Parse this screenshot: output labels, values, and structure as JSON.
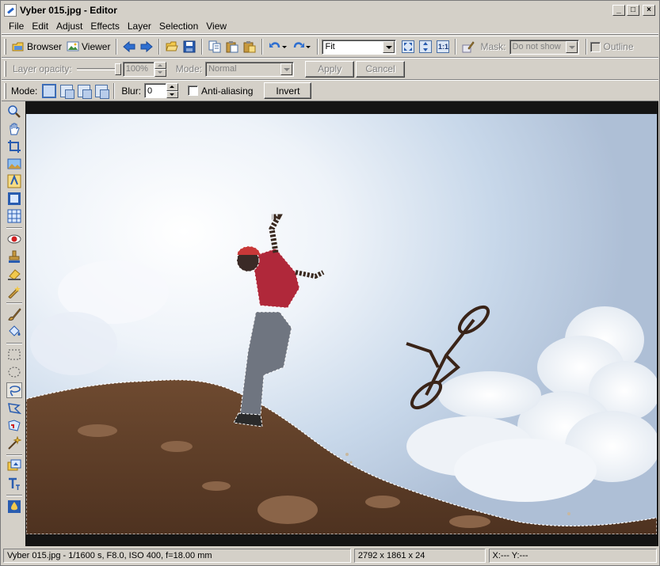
{
  "window": {
    "title": "Vyber 015.jpg - Editor",
    "controls": {
      "minimize": "_",
      "maximize": "□",
      "close": "×"
    }
  },
  "menu": [
    "File",
    "Edit",
    "Adjust",
    "Effects",
    "Layer",
    "Selection",
    "View"
  ],
  "toolbar_main": {
    "browser_label": "Browser",
    "viewer_label": "Viewer",
    "zoom_value": "Fit",
    "zoom_buttons": [
      "fit-window-icon",
      "fit-height-icon",
      "1:1"
    ],
    "mask_label": "Mask:",
    "mask_value": "Do not show",
    "outline_label": "Outline"
  },
  "toolbar_layer": {
    "opacity_label": "Layer opacity:",
    "opacity_value": "100%",
    "mode_label": "Mode:",
    "mode_value": "Normal",
    "apply_label": "Apply",
    "cancel_label": "Cancel"
  },
  "toolbar_selection": {
    "mode_label": "Mode:",
    "blur_label": "Blur:",
    "blur_value": "0",
    "antialias_label": "Anti-aliasing",
    "invert_label": "Invert"
  },
  "tools": [
    "zoom-icon",
    "hand-icon",
    "crop-icon",
    "image-icon",
    "text-tool-icon",
    "frame-icon",
    "grid-icon",
    "red-eye-icon",
    "clone-stamp-icon",
    "eraser-icon",
    "retouch-icon",
    "brush-icon",
    "fill-bucket-icon",
    "rect-select-icon",
    "ellipse-select-icon",
    "lasso-icon",
    "polygon-lasso-icon",
    "magnetic-lasso-icon",
    "magic-wand-icon",
    "layer-icon",
    "text-icon",
    "color-icon"
  ],
  "status": {
    "file_info": "Vyber 015.jpg - 1/1600 s, F8.0, ISO 400, f=18.00 mm",
    "dimensions": "2792 x 1861 x 24",
    "coords": "X:---   Y:---"
  },
  "colors": {
    "chrome": "#d4d0c8",
    "canvas_bg": "#141414",
    "sky_light": "#f4f7fb",
    "sky_blue": "#a9bcd6",
    "dirt": "#7a5236",
    "shirt": "#b0283a"
  }
}
